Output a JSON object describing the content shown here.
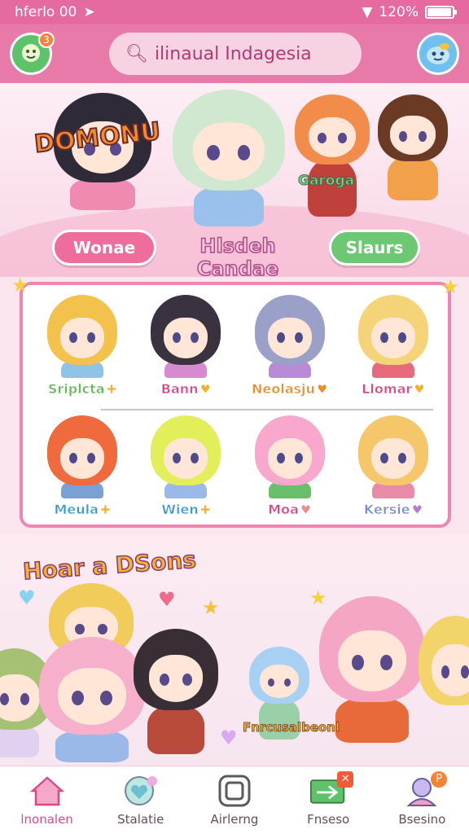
{
  "status_bar": {
    "carrier": "hferlo 00",
    "battery_percent": "120%",
    "battery_level": 0.95
  },
  "header": {
    "left_badge": "3",
    "search_text": "ilinaual Indagesia"
  },
  "hero": {
    "title": "DOMONU",
    "tag": "Garoga",
    "pill_left": "Wonae",
    "pill_center": "Hlsdeh Candae",
    "pill_right": "Slaurs"
  },
  "characters": [
    {
      "name": "Sriplcta",
      "symbol": "✚",
      "hair": "#f2c24c",
      "outfit": "#8fc3e8",
      "name_color": "#5dbb54",
      "sym_color": "#f2b12a"
    },
    {
      "name": "Bann",
      "symbol": "♥",
      "hair": "#3b3240",
      "outfit": "#d88ad0",
      "name_color": "#e0457f",
      "sym_color": "#f2b12a"
    },
    {
      "name": "Neolasju",
      "symbol": "♥",
      "hair": "#9aa0c8",
      "outfit": "#b98ad6",
      "name_color": "#f08a2a",
      "sym_color": "#f08a2a"
    },
    {
      "name": "Llomar",
      "symbol": "♥",
      "hair": "#f5d479",
      "outfit": "#e66a7a",
      "name_color": "#e0457f",
      "sym_color": "#f2b12a"
    },
    {
      "name": "Meula",
      "symbol": "✚",
      "hair": "#ef6a3c",
      "outfit": "#7aa0d4",
      "name_color": "#3a9ad6",
      "sym_color": "#f2b12a"
    },
    {
      "name": "Wien",
      "symbol": "✚",
      "hair": "#e2ef5a",
      "outfit": "#9ab8e8",
      "name_color": "#3a9ad6",
      "sym_color": "#f2b12a"
    },
    {
      "name": "Moa",
      "symbol": "♥",
      "hair": "#f7a8cc",
      "outfit": "#6abf6a",
      "name_color": "#e0457f",
      "sym_color": "#f08a8a"
    },
    {
      "name": "Kersie",
      "symbol": "♥",
      "hair": "#f5c66a",
      "outfit": "#e88aa8",
      "name_color": "#7a8ad6",
      "sym_color": "#b07ad6"
    }
  ],
  "bottom_section": {
    "title": "Hoar a DSons",
    "caption": "Fnrcusalbeonl"
  },
  "nav": [
    {
      "label": "lnonalen",
      "icon": "home-icon",
      "active": true
    },
    {
      "label": "Stalatie",
      "icon": "heart-globe-icon",
      "active": false
    },
    {
      "label": "Airlerng",
      "icon": "square-button-icon",
      "active": false
    },
    {
      "label": "Fnseso",
      "icon": "ticket-icon",
      "active": false,
      "badge": "✕"
    },
    {
      "label": "Bsesino",
      "icon": "profile-icon",
      "active": false,
      "badge": "P"
    }
  ],
  "colors": {
    "status_bar": "#e56aa0",
    "header": "#e87aa9",
    "panel_border": "#ef86b2",
    "background": "#fbe6ef"
  }
}
